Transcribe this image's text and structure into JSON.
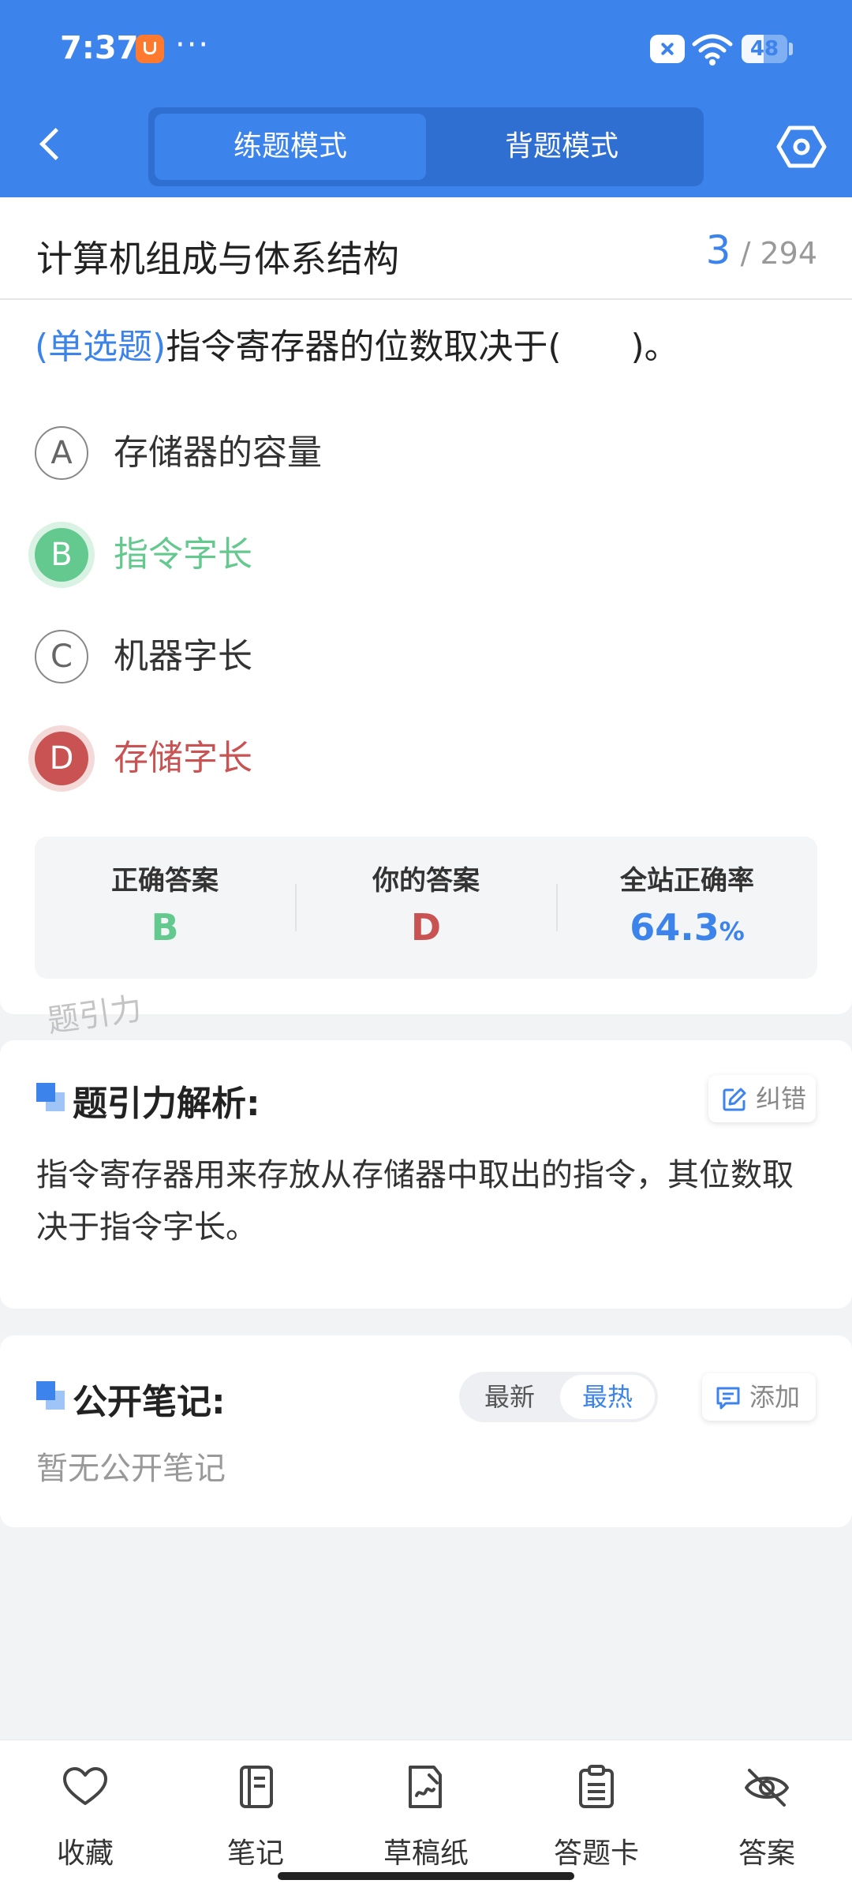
{
  "status_bar": {
    "time": "7:37",
    "dots": "···",
    "battery": 48
  },
  "header": {
    "tabs": [
      {
        "label": "练题模式",
        "active": true
      },
      {
        "label": "背题模式",
        "active": false
      }
    ]
  },
  "question": {
    "subject": "计算机组成与体系结构",
    "current": "3",
    "total": "/ 294",
    "type_label": "(单选题)",
    "text": "指令寄存器的位数取决于(　　)。",
    "options": [
      {
        "letter": "A",
        "text": "存储器的容量",
        "state": "normal"
      },
      {
        "letter": "B",
        "text": "指令字长",
        "state": "correct"
      },
      {
        "letter": "C",
        "text": "机器字长",
        "state": "normal"
      },
      {
        "letter": "D",
        "text": "存储字长",
        "state": "wrong"
      }
    ]
  },
  "answer_panel": {
    "correct_label": "正确答案",
    "correct_value": "B",
    "yours_label": "你的答案",
    "yours_value": "D",
    "rate_label": "全站正确率",
    "rate_value": "64.3",
    "rate_unit": "%"
  },
  "watermark": "题引力",
  "analysis": {
    "title": "题引力解析:",
    "report_label": "纠错",
    "text": "指令寄存器用来存放从存储器中取出的指令，其位数取决于指令字长。"
  },
  "notes": {
    "title": "公开笔记:",
    "sort_options": [
      {
        "label": "最新",
        "active": false
      },
      {
        "label": "最热",
        "active": true
      }
    ],
    "add_label": "添加",
    "empty_text": "暂无公开笔记"
  },
  "bottom_bar": [
    {
      "label": "收藏",
      "icon": "heart-icon"
    },
    {
      "label": "笔记",
      "icon": "notebook-icon"
    },
    {
      "label": "草稿纸",
      "icon": "draft-icon"
    },
    {
      "label": "答题卡",
      "icon": "answer-sheet-icon"
    },
    {
      "label": "答案",
      "icon": "eye-off-icon"
    }
  ],
  "colors": {
    "accent": "#3c84ec",
    "correct": "#64c98e",
    "wrong": "#c95252"
  }
}
